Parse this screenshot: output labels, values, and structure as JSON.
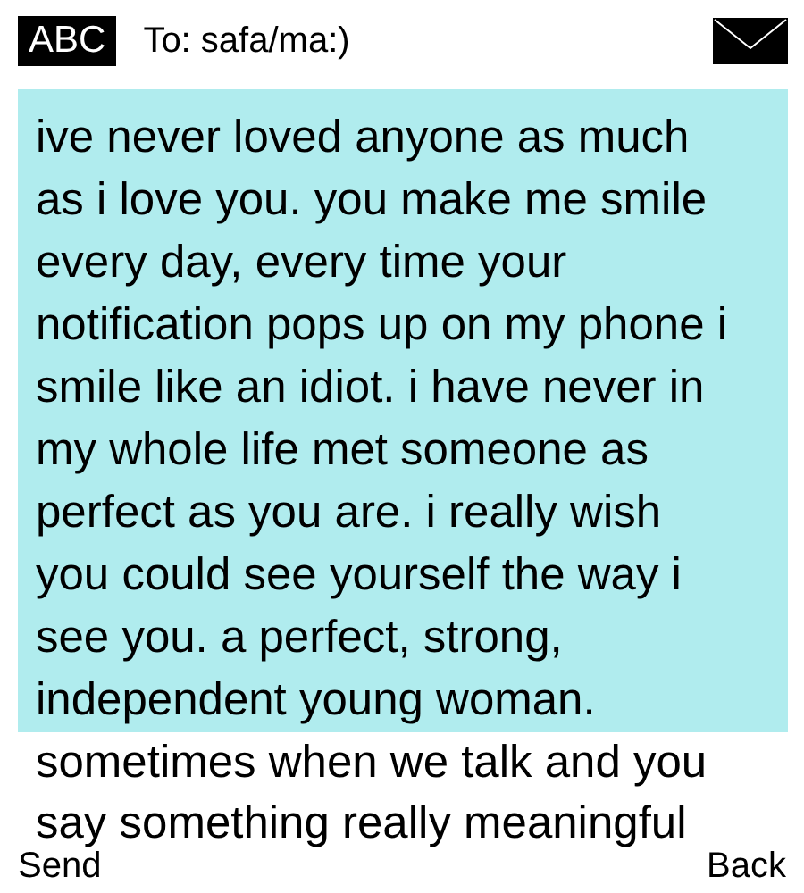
{
  "header": {
    "input_mode": "ABC",
    "recipient": "To: safa/ma:)"
  },
  "message": {
    "highlighted_lines": [
      "ive never loved anyone as much",
      "as i love you. you make me smile",
      "every day, every time your",
      "notification pops up on my phone i",
      "smile like an idiot. i have never in",
      "my whole life met someone as",
      "perfect as you are. i really wish",
      "you could see yourself the way i",
      "see you. a perfect, strong,",
      "independent young woman."
    ],
    "overflow_lines": [
      "sometimes when we talk and you",
      "say something really meaningful"
    ]
  },
  "softkeys": {
    "left": "Send",
    "right": "Back"
  }
}
